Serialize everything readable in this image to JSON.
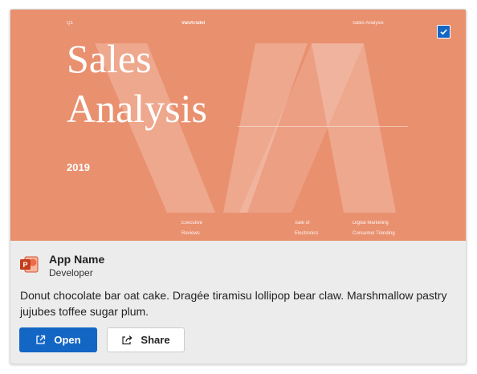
{
  "colors": {
    "accent": "#e9906f",
    "brand": "#1366c4"
  },
  "preview": {
    "top_left": "Q1",
    "top_center": "VanArsdel",
    "top_right": "Sales Analysis",
    "title_line1": "Sales",
    "title_line2": "Analysis",
    "year": "2019",
    "footer_col1_line1": "Executive",
    "footer_col1_line2": "Reviews",
    "footer_col2_line1": "Sale of",
    "footer_col2_line2": "Electronics",
    "footer_col3_line1": "Digital Marketing",
    "footer_col3_line2": "Consumer Trending",
    "checkbox_checked": true
  },
  "app": {
    "icon": "powerpoint-icon",
    "name": "App Name",
    "developer": "Developer",
    "description": "Donut chocolate bar oat cake. Dragée tiramisu lollipop bear claw. Marshmallow pastry jujubes toffee sugar plum."
  },
  "actions": {
    "open_label": "Open",
    "open_icon": "open-external-icon",
    "share_label": "Share",
    "share_icon": "share-icon"
  }
}
